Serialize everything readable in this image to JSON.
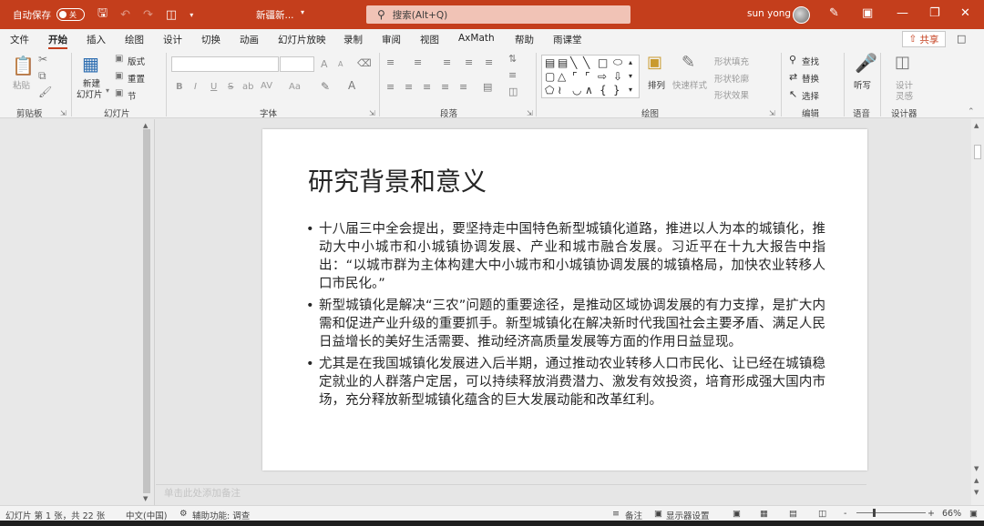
{
  "titlebar": {
    "autosave_label": "自动保存",
    "autosave_state": "关",
    "filename": "新疆新...",
    "search_placeholder": "搜索(Alt+Q)",
    "user_name": "sun yong",
    "accent_color": "#c43e1c"
  },
  "ribbon_tabs": [
    "文件",
    "开始",
    "插入",
    "绘图",
    "设计",
    "切换",
    "动画",
    "幻灯片放映",
    "录制",
    "审阅",
    "视图",
    "AxMath",
    "帮助",
    "雨课堂"
  ],
  "active_tab": "开始",
  "share_label": "共享",
  "ribbon": {
    "clipboard": {
      "label": "剪贴板",
      "paste": "粘贴"
    },
    "slides": {
      "label": "幻灯片",
      "new_slide_line1": "新建",
      "new_slide_line2": "幻灯片",
      "layout": "版式",
      "reset": "重置",
      "section": "节"
    },
    "font": {
      "label": "字体",
      "bold": "B",
      "italic": "I",
      "underline": "U",
      "strike": "S",
      "shadow": "ab",
      "spacing": "AV",
      "case": "Aa",
      "grow": "A",
      "shrink": "A"
    },
    "paragraph": {
      "label": "段落"
    },
    "drawing": {
      "label": "绘图",
      "arrange": "排列",
      "quick_styles": "快速样式",
      "fill": "形状填充",
      "outline": "形状轮廓",
      "effects": "形状效果"
    },
    "editing": {
      "label": "编辑",
      "find": "查找",
      "replace": "替换",
      "select": "选择"
    },
    "voice": {
      "label": "语音",
      "dictate": "听写"
    },
    "designer": {
      "label": "设计器",
      "design_ideas_1": "设计",
      "design_ideas_2": "灵感"
    }
  },
  "slide": {
    "title": "研究背景和意义",
    "bullets": [
      "十八届三中全会提出，要坚持走中国特色新型城镇化道路，推进以人为本的城镇化，推动大中小城市和小城镇协调发展、产业和城市融合发展。习近平在十九大报告中指出：“以城市群为主体构建大中小城市和小城镇协调发展的城镇格局，加快农业转移人口市民化。”",
      "新型城镇化是解决“三农”问题的重要途径，是推动区域协调发展的有力支撑，是扩大内需和促进产业升级的重要抓手。新型城镇化在解决新时代我国社会主要矛盾、满足人民日益增长的美好生活需要、推动经济高质量发展等方面的作用日益显现。",
      "尤其是在我国城镇化发展进入后半期，通过推动农业转移人口市民化、让已经在城镇稳定就业的人群落户定居，可以持续释放消费潜力、激发有效投资，培育形成强大国内市场，充分释放新型城镇化蕴含的巨大发展动能和改革红利。"
    ]
  },
  "notes_placeholder": "单击此处添加备注",
  "statusbar": {
    "slide_count": "幻灯片 第 1 张，共 22 张",
    "language": "中文(中国)",
    "accessibility": "辅助功能: 调查",
    "notes": "备注",
    "display_settings": "显示器设置",
    "zoom": "66%",
    "zoom_minus": "-",
    "zoom_plus": "+"
  }
}
